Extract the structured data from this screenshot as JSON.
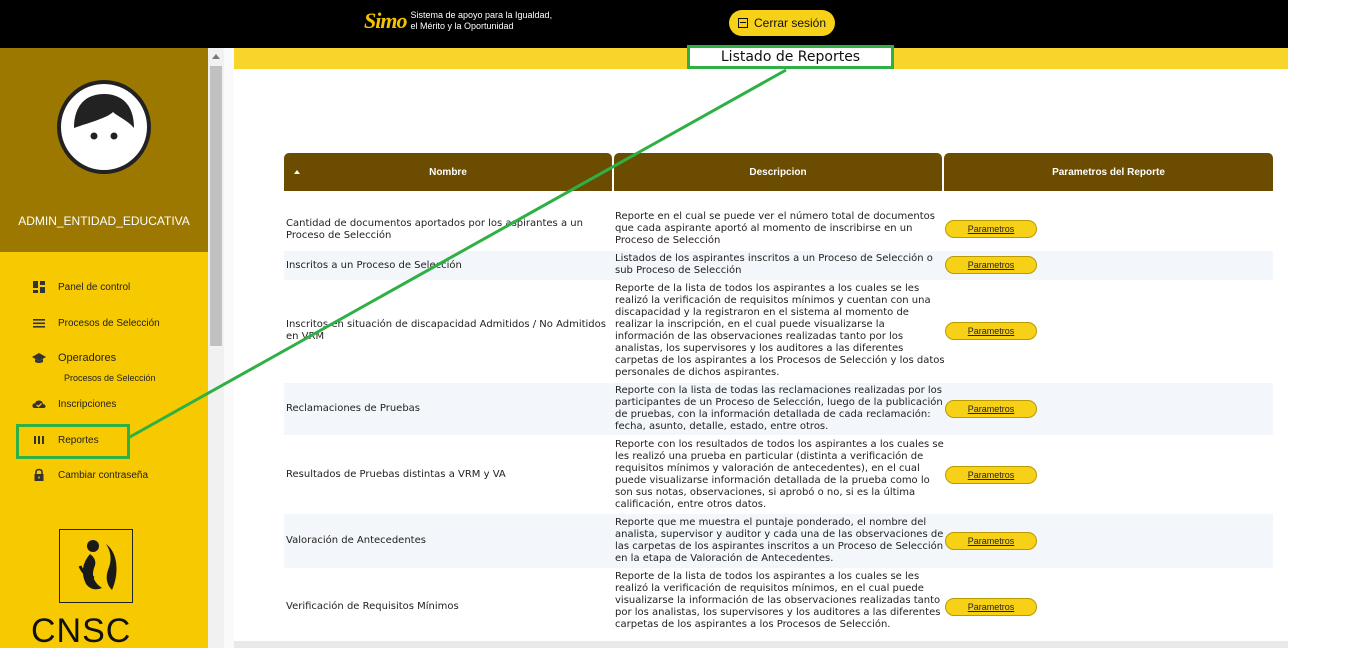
{
  "header": {
    "logo_mark": "Simo",
    "logo_line1": "Sistema de apoyo para la Igualdad,",
    "logo_line2": "el Mérito y la Oportunidad",
    "logout_label": "Cerrar sesión"
  },
  "page": {
    "title": "Listado de Reportes"
  },
  "sidebar": {
    "username": "ADMIN_ENTIDAD_EDUCATIVA",
    "items": [
      {
        "label": "Panel de control",
        "icon": "dashboard-icon"
      },
      {
        "label": "Procesos de Selección",
        "icon": "list-icon"
      },
      {
        "label": "Operadores",
        "icon": "graduation-cap-icon"
      },
      {
        "label": "Inscripciones",
        "icon": "cloud-check-icon"
      },
      {
        "label": "Reportes",
        "icon": "columns-icon"
      },
      {
        "label": "Cambiar contraseña",
        "icon": "lock-icon"
      }
    ],
    "operadores_sub": "Procesos de Selección",
    "org_name": "CNSC"
  },
  "table": {
    "columns": [
      "Nombre",
      "Descripcion",
      "Parametros del Reporte"
    ],
    "button_label": "Parametros",
    "rows": [
      {
        "name": "Cantidad de documentos aportados por los aspirantes a un Proceso de Selección",
        "desc": "Reporte en el cual se puede ver el número total de documentos que cada aspirante aportó al momento de inscribirse en un Proceso de Selección"
      },
      {
        "name": "Inscritos a un Proceso de Selección",
        "desc": "Listados de los aspirantes inscritos a un Proceso de Selección o sub Proceso de Selección"
      },
      {
        "name": "Inscritos en situación de discapacidad Admitidos / No Admitidos en VRM",
        "desc": "Reporte de la lista de todos los aspirantes a los cuales se les realizó la verificación de requisitos mínimos y cuentan con una discapacidad y la registraron en el sistema al momento de realizar la inscripción, en el cual puede visualizarse la información de las observaciones realizadas tanto por los analistas, los supervisores y los auditores a las diferentes carpetas de los aspirantes a los Procesos de Selección y los datos personales de dichos aspirantes."
      },
      {
        "name": "Reclamaciones de Pruebas",
        "desc": "Reporte con la lista de todas las reclamaciones realizadas por los participantes de un Proceso de Selección, luego de la publicación de pruebas, con la información detallada de cada reclamación: fecha, asunto, detalle, estado, entre otros."
      },
      {
        "name": "Resultados de Pruebas distintas a VRM y VA",
        "desc": "Reporte con los resultados de todos los aspirantes a los cuales se les realizó una prueba en particular (distinta a verificación de requisitos mínimos y valoración de antecedentes), en el cual puede visualizarse información detallada de la prueba como lo son sus notas, observaciones, si aprobó o no, si es la última calificación, entre otros datos."
      },
      {
        "name": "Valoración de Antecedentes",
        "desc": "Reporte que me muestra el puntaje ponderado, el nombre del analista, supervisor y auditor y cada una de las observaciones de las carpetas de los aspirantes inscritos a un Proceso de Selección en la etapa de Valoración de Antecedentes."
      },
      {
        "name": "Verificación de Requisitos Mínimos",
        "desc": "Reporte de la lista de todos los aspirantes a los cuales se les realizó la verificación de requisitos mínimos, en el cual puede visualizarse la información de las observaciones realizadas tanto por los analistas, los supervisores y los auditores a las diferentes carpetas de los aspirantes a los Procesos de Selección."
      }
    ]
  },
  "colors": {
    "brand_yellow": "#f7c900",
    "header_brown": "#6b4c00",
    "annotation_green": "#2eb045"
  }
}
